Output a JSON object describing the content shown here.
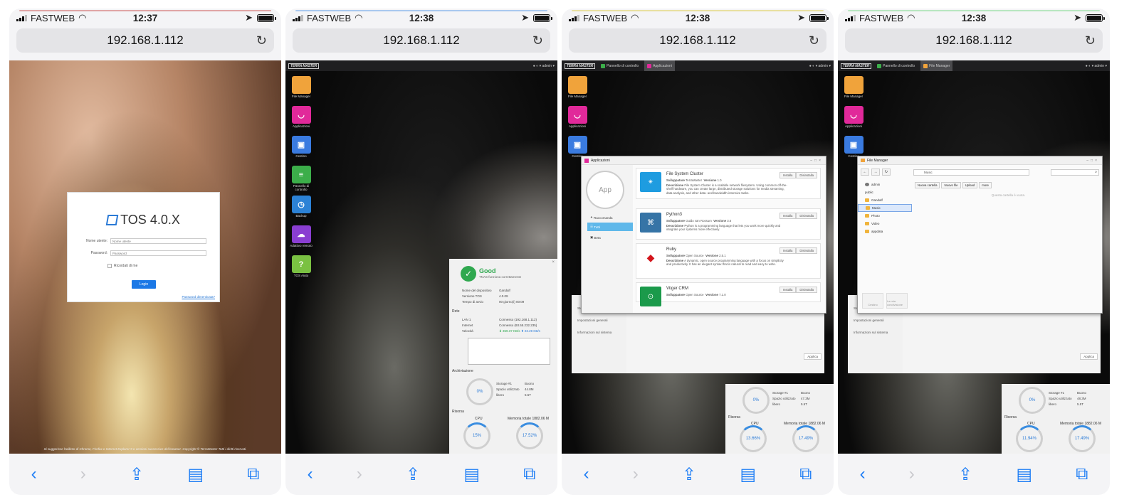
{
  "colors": {
    "ios_blue": "#1b7cf5",
    "good_green": "#2fa84f",
    "accent_blue": "#2a7bd8"
  },
  "status": {
    "carrier": "FASTWEB",
    "times": [
      "12:37",
      "12:38",
      "12:38",
      "12:38"
    ]
  },
  "browser": {
    "url": "192.168.1.112"
  },
  "toolbar_icons": [
    "back-icon",
    "forward-icon",
    "share-icon",
    "bookmarks-icon",
    "tabs-icon"
  ],
  "login": {
    "product": "TOS 4.0.X",
    "username_label": "Nome utente:",
    "username_placeholder": "Nome utente",
    "password_label": "Password:",
    "password_placeholder": "Password",
    "remember": "Ricordati di me",
    "button": "Login",
    "forgot": "Password dimenticata?",
    "footer": "Si suggerisce l'utilizzo di Chrome, Firefox o Internet Explorer 9 o versioni successive del browser. Copyright © TerraMaster Tutti i diritti riservati."
  },
  "desktop": {
    "brand": "TERRA MASTER",
    "user": "admin",
    "icons": [
      "File Manager",
      "Applicazioni",
      "Cestino",
      "Pannello di controllo",
      "Backup",
      "Adattivo remoto",
      "TOS Aiuto"
    ],
    "tabs": {
      "control": "Pannello di controllo",
      "apps": "Applicazioni",
      "fm": "File Manager"
    }
  },
  "panel": {
    "status": "Good",
    "status_sub": "TNAS funziona correttamente",
    "device_label": "Nome del dispositivo",
    "device": "Gandalf",
    "tos_label": "Versione TOS",
    "tos": "4.0.09",
    "uptime_label": "Tempo di avvio",
    "uptime": "00 giorno(i) 00:09",
    "net_title": "Rete",
    "lan_label": "LAN 1",
    "lan": "Connesso (192.168.1.112)",
    "internet_label": "Internet",
    "internet": "Connesso (93.55.232.235)",
    "speed_label": "Velocità",
    "down": "359.37 KB/s",
    "up": "23.29 KB/s",
    "storage_title": "Archiviazione",
    "storage_label": "Storage #1",
    "storage_state": "Buono",
    "used_label": "Spazio utilizzato",
    "used": "44.8M",
    "free_label": "libero",
    "free": "5.5T",
    "storage_pct": "0%",
    "res_title": "Risorsa",
    "cpu_label": "CPU",
    "mem_label": "Memoria totale 1882.06 M",
    "cpu": "15%",
    "mem": "17.52%"
  },
  "apps_window": {
    "title": "Applicazioni",
    "circle": "App",
    "cats": [
      "Raccomanda",
      "Tutti",
      "Beta"
    ],
    "dev_label": "Sviluppatore",
    "ver_label": "Versione",
    "desc_label": "Descrizione",
    "install": "Installa",
    "uninstall": "Disinstalla",
    "items": [
      {
        "name": "File System Cluster",
        "dev": "TerraMaster",
        "ver": "1.0",
        "desc": "File System Cluster is a scalable network filesystem. Using common off-the-shelf hardware, you can create large, distributed storage solutions for media streaming, data analysis, and other data- and bandwidth-intensive tasks."
      },
      {
        "name": "Python3",
        "dev": "Guido van Rossum",
        "ver": "3.6",
        "desc": "Python is a programming language that lets you work more quickly and integrate your systems more effectively."
      },
      {
        "name": "Ruby",
        "dev": "Open Source",
        "ver": "2.5.1",
        "desc": "A dynamic, open source programming language with a focus on simplicity and productivity. It has an elegant syntax that is natural to read and easy to write."
      },
      {
        "name": "Vtiger CRM",
        "dev": "Open Source",
        "ver": "7.1.0",
        "desc": ""
      }
    ],
    "behind": [
      "Storage manager",
      "Impostazioni generali",
      "Informazioni sul sistema"
    ],
    "apply": "Applica",
    "storage_used": "47.3M",
    "storage_pct": "0%",
    "cpu": "13.66%",
    "mem": "17.49%"
  },
  "fm_window": {
    "title": "File Manager",
    "path": "Music",
    "tree": [
      "admin",
      "public",
      "Gandalf",
      "Music",
      "Photo",
      "Video",
      "appdata"
    ],
    "tools": [
      "Nuova cartella",
      "Nuovo file",
      "Upload",
      "more"
    ],
    "empty": "Questa cartella è vuota.",
    "bottom": [
      "Cestino",
      "La mia condivisione"
    ],
    "behind": [
      "Storage manager",
      "Impostazioni generali",
      "Informazioni sul sistema"
    ],
    "apply": "Applica",
    "storage_used": "48.3M",
    "storage_pct": "0%",
    "cpu": "11.94%",
    "mem": "17.49%"
  }
}
